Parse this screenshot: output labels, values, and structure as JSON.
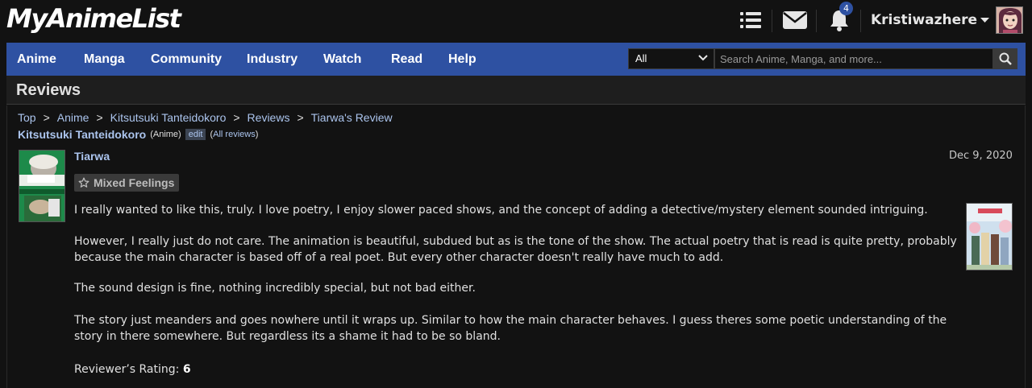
{
  "header": {
    "logo": "MyAnimeList",
    "notification_count": "4",
    "username": "Kristiwazhere",
    "icons": [
      "list-icon",
      "mail-icon",
      "bell-icon",
      "caret-down-icon",
      "avatar"
    ]
  },
  "nav": {
    "items": [
      "Anime",
      "Manga",
      "Community",
      "Industry",
      "Watch",
      "Read",
      "Help"
    ]
  },
  "search": {
    "category": "All",
    "placeholder": "Search Anime, Manga, and more..."
  },
  "page": {
    "title": "Reviews"
  },
  "breadcrumb": [
    "Top",
    "Anime",
    "Kitsutsuki Tanteidokoro",
    "Reviews",
    "Tiarwa's Review"
  ],
  "anime": {
    "title": "Kitsutsuki Tanteidokoro",
    "type": "(Anime)",
    "edit_label": "edit",
    "all_reviews_open": "(",
    "all_reviews_label": "All reviews",
    "all_reviews_close": ")"
  },
  "review": {
    "reviewer": "Tiarwa",
    "date": "Dec 9, 2020",
    "tag": "Mixed Feelings",
    "paragraphs": [
      "I really wanted to like this, truly. I love poetry, I enjoy slower paced shows, and the concept of adding a detective/mystery element sounded intriguing.",
      "However, I really just do not care. The animation is beautiful, subdued but as is the tone of the show. The actual poetry that is read is quite pretty, probably because the main character is based off of a real poet. But every other character doesn't really have much to add.",
      "The sound design is fine, nothing incredibly special, but not bad either.",
      "The story just meanders and goes nowhere until it wraps up. Similar to how the main character behaves. I guess theres some poetic understanding of the story in there somewhere. But regardless its a shame it had to be so bland."
    ],
    "rating_label": "Reviewer’s Rating:",
    "rating_value": "6"
  },
  "colors": {
    "background": "#121212",
    "nav_blue": "#2e51a2",
    "link": "#abc4ed",
    "text": "#e0e0e0"
  }
}
